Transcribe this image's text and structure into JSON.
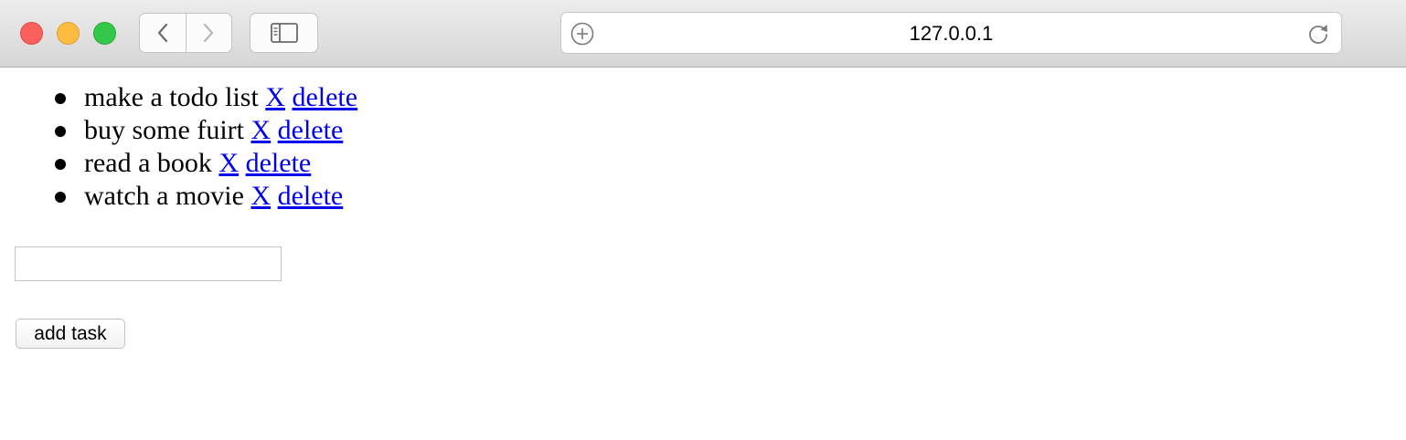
{
  "browser": {
    "url": "127.0.0.1"
  },
  "todos": [
    {
      "text": "make a todo list",
      "x_link": "X",
      "delete_link": "delete"
    },
    {
      "text": "buy some fuirt",
      "x_link": "X",
      "delete_link": "delete"
    },
    {
      "text": "read a book",
      "x_link": "X",
      "delete_link": "delete"
    },
    {
      "text": "watch a movie",
      "x_link": "X",
      "delete_link": "delete"
    }
  ],
  "new_task": {
    "value": "",
    "button_label": "add task"
  },
  "colors": {
    "link": "#0000ee",
    "close": "#fc605c",
    "minimize": "#fdbc40",
    "zoom": "#34c84a"
  }
}
